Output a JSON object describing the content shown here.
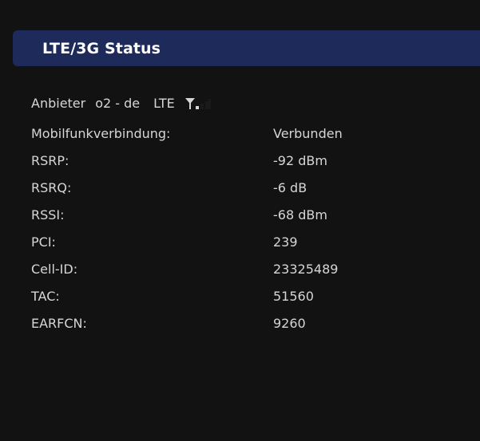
{
  "header": {
    "title": "LTE/3G Status"
  },
  "provider": {
    "label": "Anbieter",
    "name": "o2 - de",
    "technology": "LTE",
    "signal_icon": "signal-strength-icon",
    "signal_bars_active": 1,
    "signal_bars_total": 4
  },
  "rows": [
    {
      "label": "Mobilfunkverbindung:",
      "value": "Verbunden"
    },
    {
      "label": "RSRP:",
      "value": "-92 dBm"
    },
    {
      "label": "RSRQ:",
      "value": "-6 dB"
    },
    {
      "label": "RSSI:",
      "value": "-68 dBm"
    },
    {
      "label": "PCI:",
      "value": "239"
    },
    {
      "label": "Cell-ID:",
      "value": "23325489"
    },
    {
      "label": "TAC:",
      "value": "51560"
    },
    {
      "label": "EARFCN:",
      "value": "9260"
    }
  ],
  "colors": {
    "background": "#121212",
    "header_bar": "#1d2a5a",
    "text": "#d6d6d6"
  }
}
